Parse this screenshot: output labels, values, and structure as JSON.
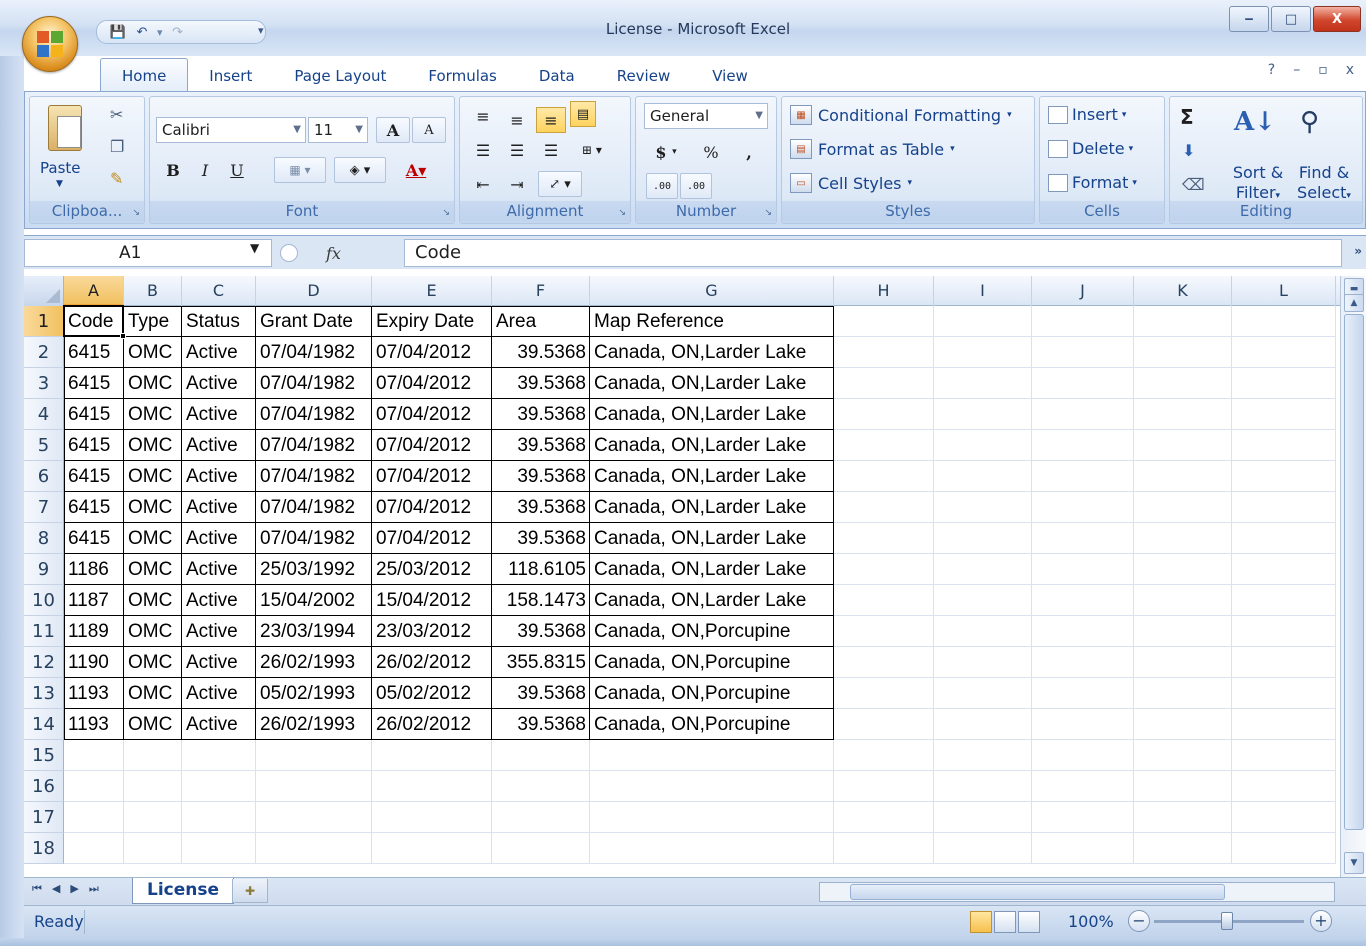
{
  "window": {
    "title": "License - Microsoft Excel",
    "minimize": "‒",
    "maximize": "□",
    "close": "X"
  },
  "qat": {
    "save": "💾",
    "undo": "↶",
    "redo": "↷",
    "dropdown": "▾"
  },
  "tabs": [
    "Home",
    "Insert",
    "Page Layout",
    "Formulas",
    "Data",
    "Review",
    "View"
  ],
  "ribbon": {
    "clipboard": {
      "label": "Clipboa...",
      "paste": "Paste"
    },
    "font": {
      "label": "Font",
      "name": "Calibri",
      "size": "11",
      "grow": "A",
      "shrink": "A",
      "bold": "B",
      "italic": "I",
      "underline": "U",
      "fontcolor": "A"
    },
    "alignment": {
      "label": "Alignment"
    },
    "number": {
      "label": "Number",
      "format": "General",
      "currency": "$",
      "percent": "%",
      "comma": ",",
      "inc": ".00",
      "dec": ".00"
    },
    "styles": {
      "label": "Styles",
      "conditional": "Conditional Formatting",
      "format_table": "Format as Table",
      "cell_styles": "Cell Styles"
    },
    "cells": {
      "label": "Cells",
      "insert": "Insert",
      "delete": "Delete",
      "format": "Format"
    },
    "editing": {
      "label": "Editing",
      "sigma": "Σ",
      "sort": "Sort &",
      "filter": "Filter",
      "find": "Find &",
      "select": "Select"
    }
  },
  "formula_bar": {
    "name_box": "A1",
    "fx": "fx",
    "value": "Code"
  },
  "columns": [
    "A",
    "B",
    "C",
    "D",
    "E",
    "F",
    "G",
    "H",
    "I",
    "J",
    "K",
    "L"
  ],
  "rows": [
    "1",
    "2",
    "3",
    "4",
    "5",
    "6",
    "7",
    "8",
    "9",
    "10",
    "11",
    "12",
    "13",
    "14",
    "15",
    "16",
    "17",
    "18"
  ],
  "table": {
    "headers": [
      "Code",
      "Type",
      "Status",
      "Grant Date",
      "Expiry Date",
      "Area",
      "Map Reference"
    ],
    "rows": [
      [
        "6415",
        "OMC",
        "Active",
        "07/04/1982",
        "07/04/2012",
        "39.5368",
        "Canada, ON,Larder Lake"
      ],
      [
        "6415",
        "OMC",
        "Active",
        "07/04/1982",
        "07/04/2012",
        "39.5368",
        "Canada, ON,Larder Lake"
      ],
      [
        "6415",
        "OMC",
        "Active",
        "07/04/1982",
        "07/04/2012",
        "39.5368",
        "Canada, ON,Larder Lake"
      ],
      [
        "6415",
        "OMC",
        "Active",
        "07/04/1982",
        "07/04/2012",
        "39.5368",
        "Canada, ON,Larder Lake"
      ],
      [
        "6415",
        "OMC",
        "Active",
        "07/04/1982",
        "07/04/2012",
        "39.5368",
        "Canada, ON,Larder Lake"
      ],
      [
        "6415",
        "OMC",
        "Active",
        "07/04/1982",
        "07/04/2012",
        "39.5368",
        "Canada, ON,Larder Lake"
      ],
      [
        "6415",
        "OMC",
        "Active",
        "07/04/1982",
        "07/04/2012",
        "39.5368",
        "Canada, ON,Larder Lake"
      ],
      [
        "1186",
        "OMC",
        "Active",
        "25/03/1992",
        "25/03/2012",
        "118.6105",
        "Canada, ON,Larder Lake"
      ],
      [
        "1187",
        "OMC",
        "Active",
        "15/04/2002",
        "15/04/2012",
        "158.1473",
        "Canada, ON,Larder Lake"
      ],
      [
        "1189",
        "OMC",
        "Active",
        "23/03/1994",
        "23/03/2012",
        "39.5368",
        "Canada, ON,Porcupine"
      ],
      [
        "1190",
        "OMC",
        "Active",
        "26/02/1993",
        "26/02/2012",
        "355.8315",
        "Canada, ON,Porcupine"
      ],
      [
        "1193",
        "OMC",
        "Active",
        "05/02/1993",
        "05/02/2012",
        "39.5368",
        "Canada, ON,Porcupine"
      ],
      [
        "1193",
        "OMC",
        "Active",
        "26/02/1993",
        "26/02/2012",
        "39.5368",
        "Canada, ON,Porcupine"
      ]
    ]
  },
  "sheet": {
    "tab": "License"
  },
  "status": {
    "text": "Ready",
    "zoom": "100%"
  },
  "colors": {
    "accent": "#15428b",
    "selected_header": "#f1c15f"
  }
}
